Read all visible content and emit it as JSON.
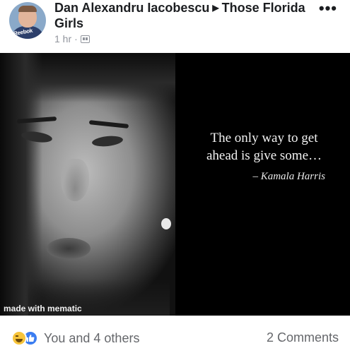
{
  "post": {
    "author": "Dan Alexandru Iacobescu",
    "group": "Those Florida Girls",
    "time": "1 hr",
    "separator": "·",
    "more_label": "•••"
  },
  "image": {
    "quote": "The only way to get ahead is give some…",
    "attribution": "– Kamala Harris",
    "watermark": "made with mematic"
  },
  "footer": {
    "reaction_text": "You and 4 others",
    "comments_text": "2 Comments"
  },
  "avatar": {
    "shirt_text": "Reebok"
  },
  "icons": {
    "reaction_icons": [
      "haha-icon",
      "like-icon"
    ],
    "group_privacy_icon": "group-icon",
    "arrow_icon": "right-triangle-icon"
  },
  "colors": {
    "link_text": "#1c1e21",
    "meta_text": "#90949c",
    "like_blue": "#3b7df1",
    "haha_yellow": "#f7c43b"
  }
}
